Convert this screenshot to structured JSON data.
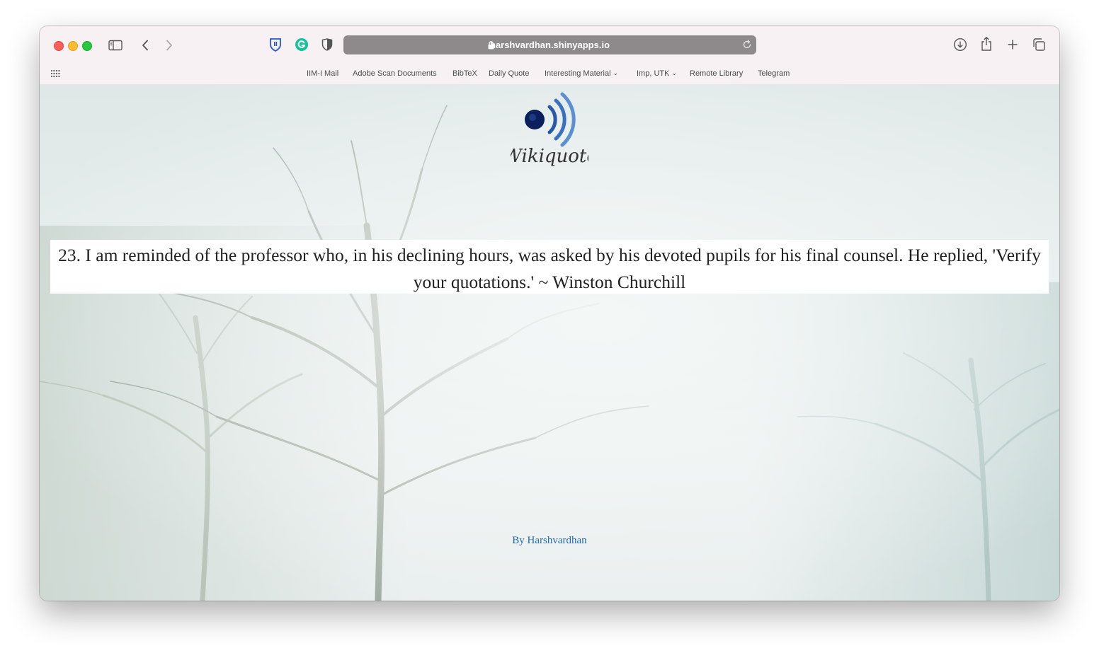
{
  "browser": {
    "url": "harshvardhan.shinyapps.io",
    "bookmarks": [
      {
        "label": "IIM-I Mail",
        "dropdown": false
      },
      {
        "label": "Adobe Scan Documents",
        "dropdown": false
      },
      {
        "label": "BibTeX",
        "dropdown": false
      },
      {
        "label": "Daily Quote",
        "dropdown": false
      },
      {
        "label": "Interesting Material",
        "dropdown": true
      },
      {
        "label": "Imp, UTK",
        "dropdown": true
      },
      {
        "label": "Remote Library",
        "dropdown": false
      },
      {
        "label": "Telegram",
        "dropdown": false
      }
    ],
    "icons": [
      "sidebar-icon",
      "back-icon",
      "forward-icon",
      "bitwarden-icon",
      "grammarly-icon",
      "privacy-shield-icon",
      "lock-icon",
      "reload-icon",
      "download-icon",
      "share-icon",
      "new-tab-icon",
      "tab-overview-icon",
      "bookmarks-grid-icon"
    ]
  },
  "page": {
    "logo_text": "Wikiquote",
    "quote": "23. I am reminded of the professor who, in his declining hours, was asked by his devoted pupils for his final counsel. He replied, 'Verify your quotations.' ~ Winston Churchill",
    "byline": "By Harshvardhan"
  },
  "colors": {
    "toolbar_bg": "#f7f1f3",
    "url_bar_bg": "#8e8a8b",
    "quote_box_bg": "#ffffff",
    "byline_color": "#1f6ab0",
    "logo_blue_dark": "#0a1f5c",
    "logo_blue_light": "#5b8fd1"
  }
}
